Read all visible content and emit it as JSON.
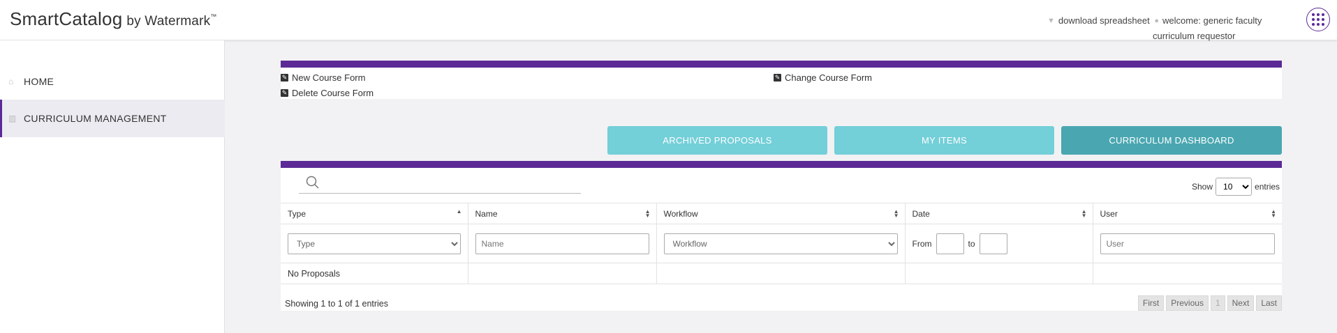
{
  "header": {
    "brand": "SmartCatalog",
    "brand_sub": "by Watermark",
    "brand_tm": "™",
    "download": "download spreadsheet",
    "welcome": "welcome: generic faculty",
    "role": "curriculum requestor"
  },
  "sidebar": {
    "items": [
      {
        "label": "HOME"
      },
      {
        "label": "CURRICULUM MANAGEMENT"
      }
    ]
  },
  "forms": {
    "new_course": "New Course Form",
    "delete_course": "Delete Course Form",
    "change_course": "Change Course Form"
  },
  "tabs": {
    "archived": "ARCHIVED PROPOSALS",
    "my_items": "MY ITEMS",
    "dashboard": "CURRICULUM DASHBOARD"
  },
  "table": {
    "show_label": "Show",
    "entries_label": "entries",
    "page_size": "10",
    "columns": [
      "Type",
      "Name",
      "Workflow",
      "Date",
      "User"
    ],
    "filters": {
      "type_placeholder": "Type",
      "name_placeholder": "Name",
      "workflow_placeholder": "Workflow",
      "date_from": "From",
      "date_to": "to",
      "user_placeholder": "User"
    },
    "empty_message": "No Proposals",
    "info": "Showing 1 to 1 of 1 entries",
    "pager": {
      "first": "First",
      "previous": "Previous",
      "current": "1",
      "next": "Next",
      "last": "Last"
    }
  },
  "colors": {
    "accent": "#5b2a96",
    "teal": "#73cfd8",
    "teal_active": "#4aa7b1"
  }
}
